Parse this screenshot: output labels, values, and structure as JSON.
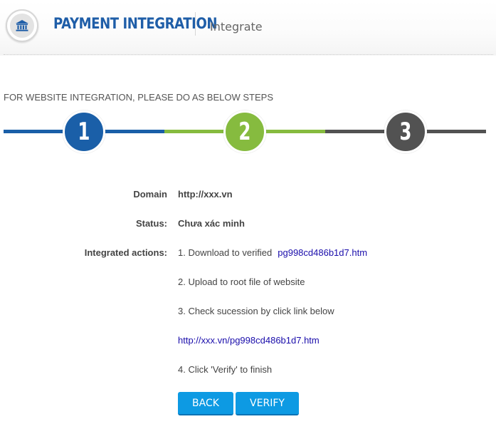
{
  "header": {
    "logo_icon": "bank-icon",
    "title": "PAYMENT INTEGRATION",
    "tab": "Integrate"
  },
  "colors": {
    "brand_blue": "#1f5ea8",
    "step1": "#1a5fa8",
    "step2": "#86bb3f",
    "step3": "#525252",
    "button": "#0d9ae3"
  },
  "steps": {
    "instructions": "FOR WEBSITE INTEGRATION, PLEASE DO AS BELOW STEPS",
    "items": [
      {
        "number": "1",
        "state": "done"
      },
      {
        "number": "2",
        "state": "current"
      },
      {
        "number": "3",
        "state": "pending"
      }
    ]
  },
  "form": {
    "domain_label": "Domain",
    "domain_value": "http://xxx.vn",
    "status_label": "Status:",
    "status_value": "Chưa xác minh",
    "actions_label": "Integrated actions:",
    "action1_text": "1. Download to verified",
    "action1_file": "pg998cd486b1d7.htm",
    "action2_text": "2. Upload to root file of website",
    "action3_text": "3. Check sucession by click link below",
    "verify_link": "http://xxx.vn/pg998cd486b1d7.htm",
    "action4_text": "4. Click 'Verify' to finish"
  },
  "buttons": {
    "back": "BACK",
    "verify": "VERIFY"
  }
}
